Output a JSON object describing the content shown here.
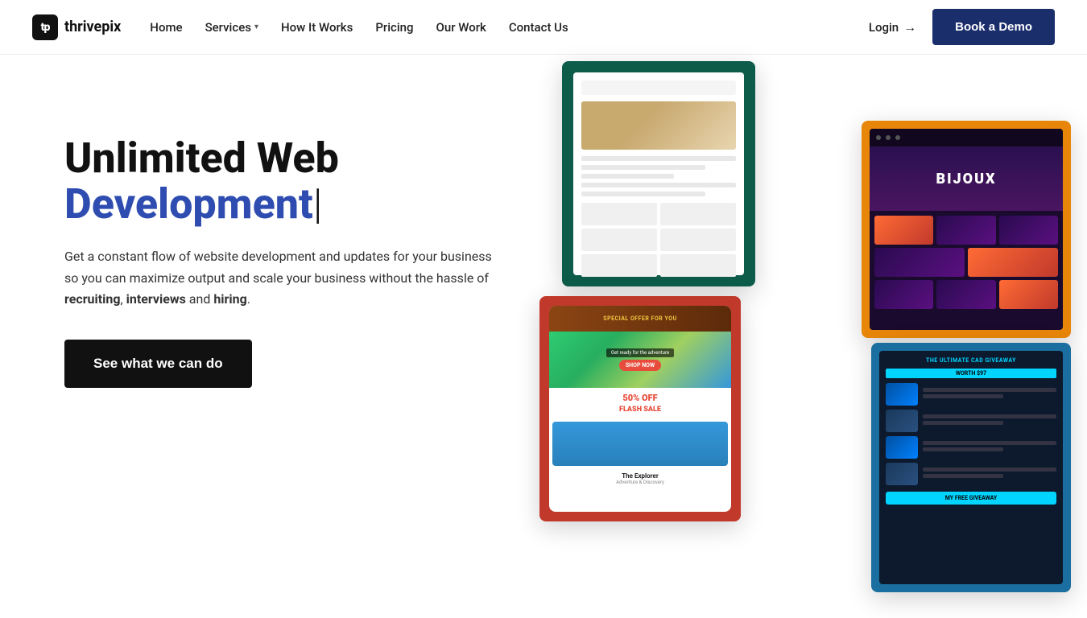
{
  "logo": {
    "icon_text": "tp",
    "brand_name": "thrivepix"
  },
  "nav": {
    "home_label": "Home",
    "services_label": "Services",
    "how_it_works_label": "How It Works",
    "pricing_label": "Pricing",
    "our_work_label": "Our Work",
    "contact_label": "Contact Us",
    "login_label": "Login",
    "book_demo_label": "Book a Demo"
  },
  "hero": {
    "title_part1": "Unlimited Web ",
    "title_highlight": "Development",
    "title_cursor": "|",
    "description": "Get a constant flow of website development and updates for your business so you can maximize output and scale your business without the hassle of ",
    "desc_bold1": "recruiting",
    "desc_sep1": ", ",
    "desc_bold2": "interviews",
    "desc_sep2": " and ",
    "desc_bold3": "hiring",
    "desc_end": ".",
    "cta_label": "See what we can do"
  },
  "colors": {
    "accent_blue": "#2f4db0",
    "dark_navy": "#1a2e6c",
    "black": "#111"
  }
}
